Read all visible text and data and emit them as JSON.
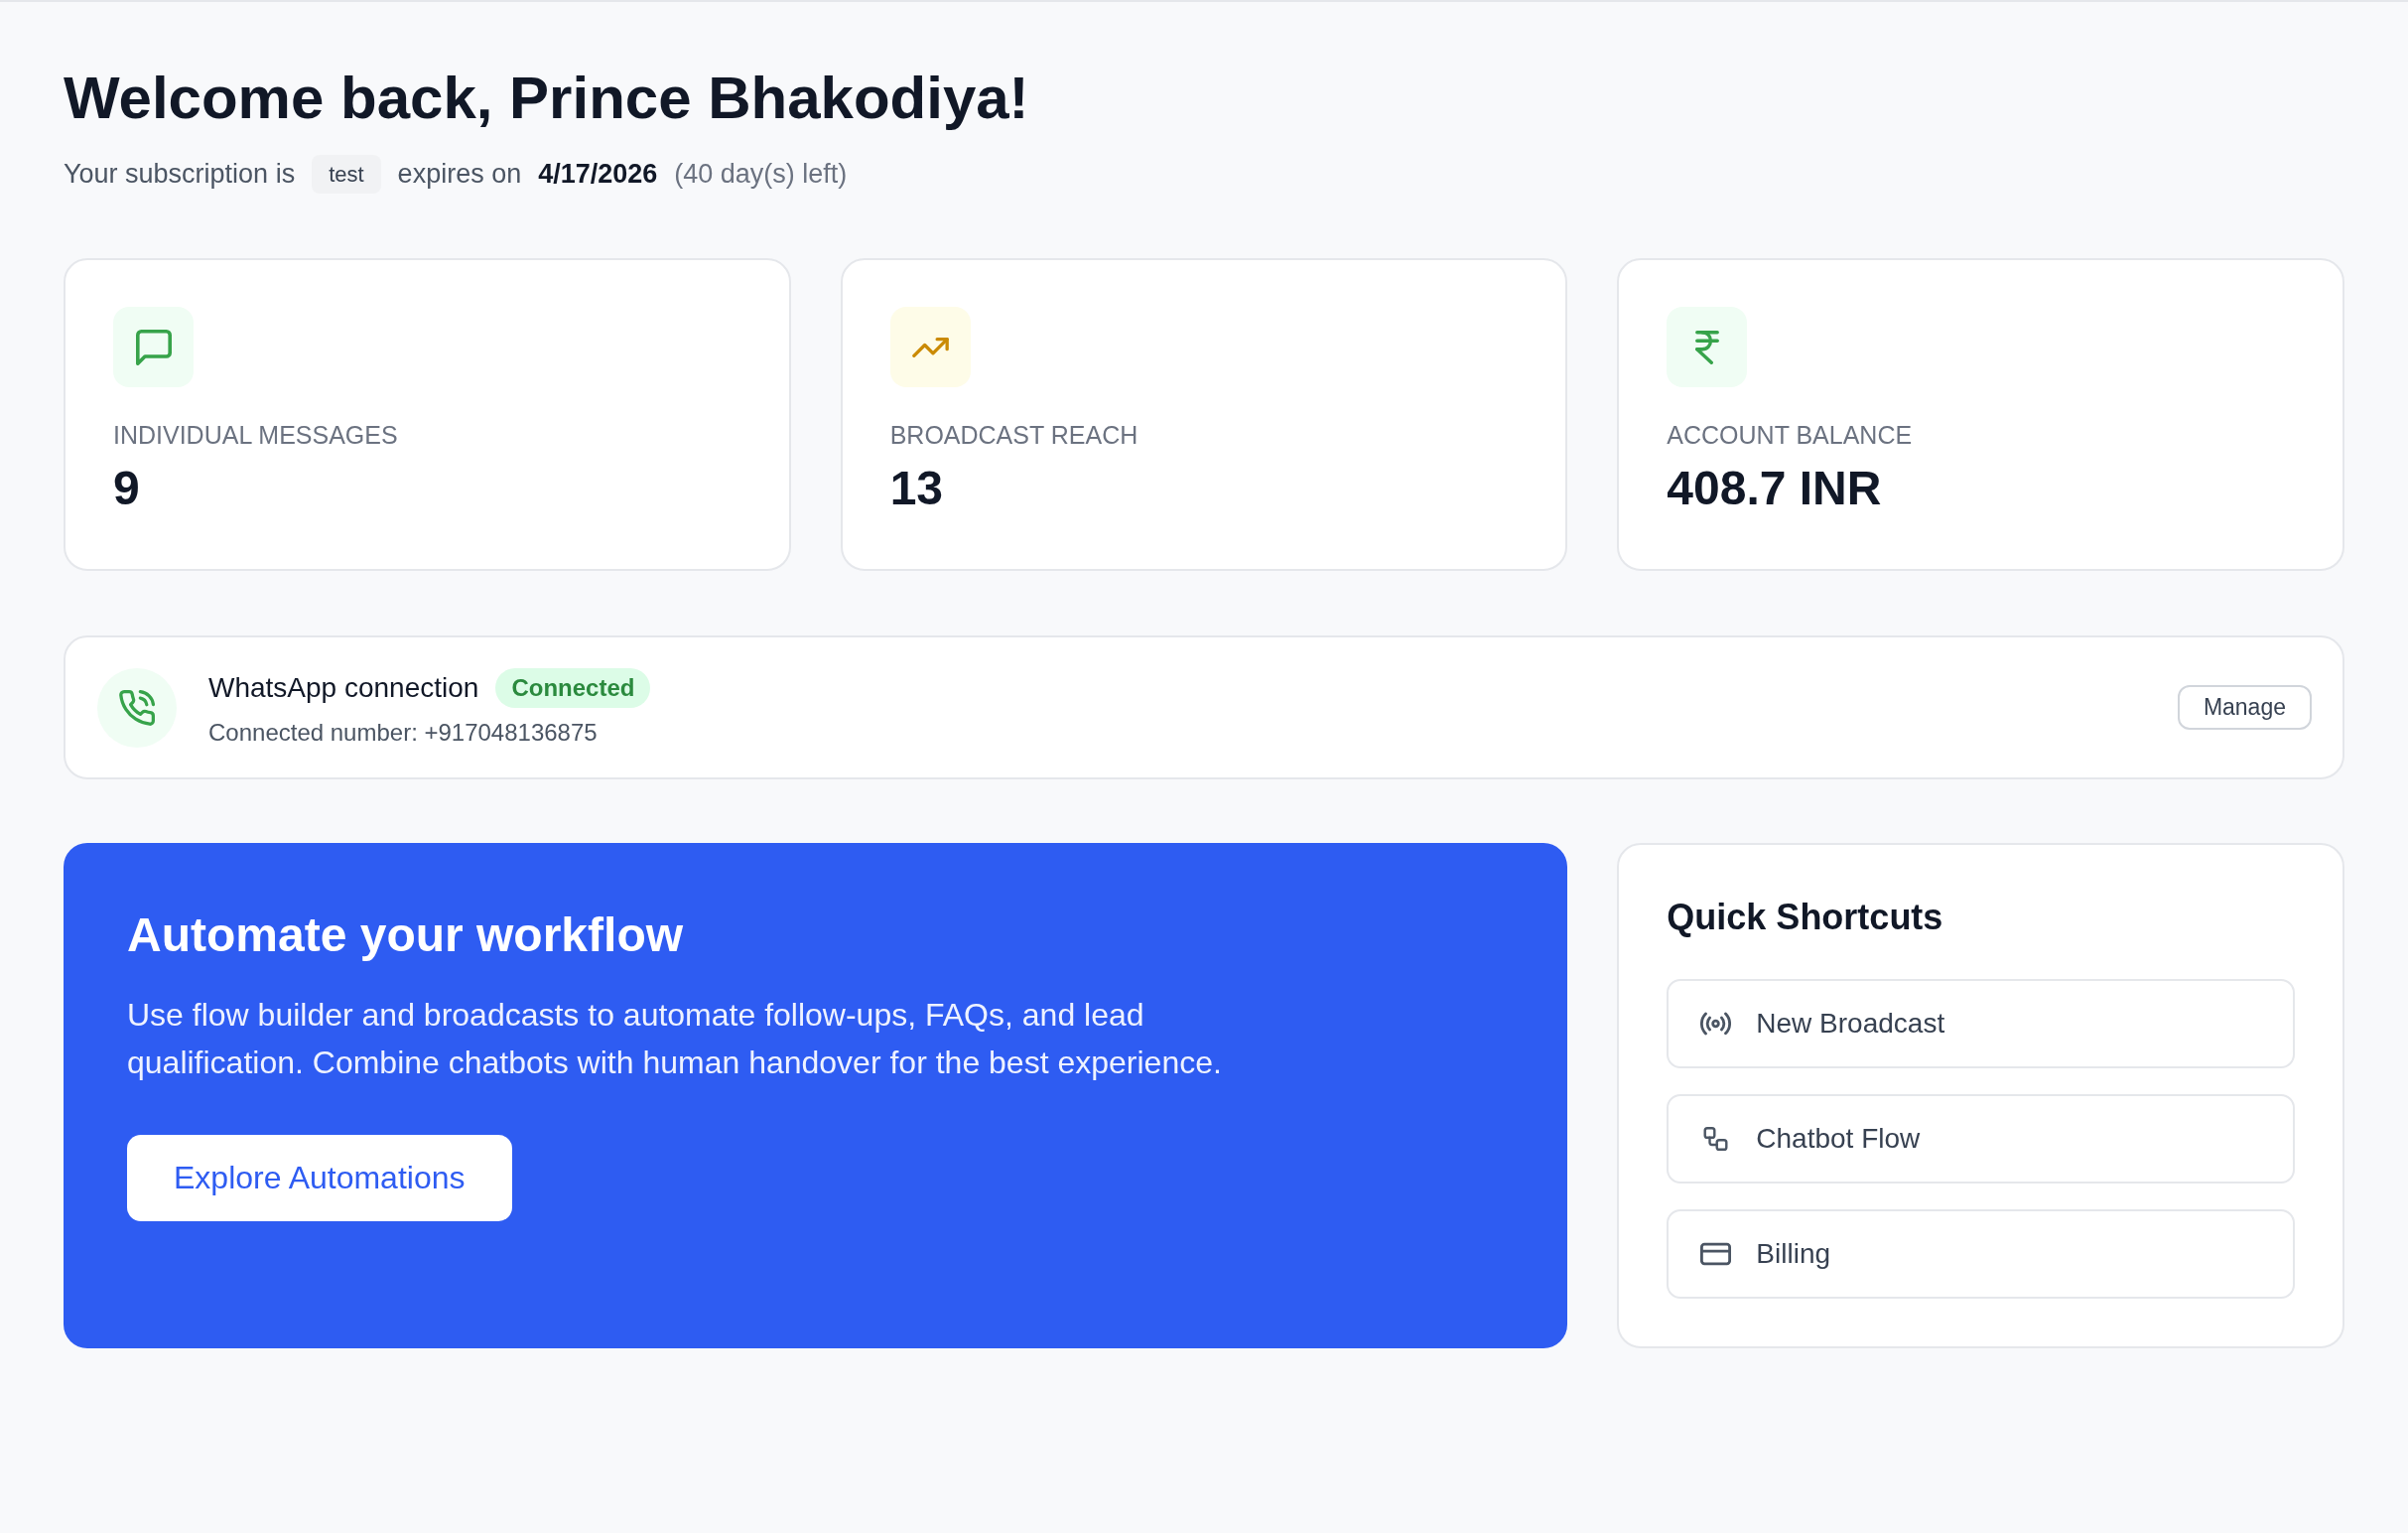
{
  "header": {
    "title": "Welcome back, Prince Bhakodiya!",
    "subscription": {
      "prefix": "Your subscription is",
      "plan": "test",
      "expires_label": "expires on",
      "expiry_date": "4/17/2026",
      "days_left": "(40 day(s) left)"
    }
  },
  "stats": [
    {
      "kind": "messages",
      "label": "INDIVIDUAL MESSAGES",
      "value": "9"
    },
    {
      "kind": "reach",
      "label": "BROADCAST REACH",
      "value": "13"
    },
    {
      "kind": "balance",
      "label": "ACCOUNT BALANCE",
      "value": "408.7 INR"
    }
  ],
  "whatsapp": {
    "title": "WhatsApp connection",
    "status": "Connected",
    "connected": true,
    "number": "Connected number: +917048136875",
    "manage_button": "Manage"
  },
  "automation": {
    "title": "Automate your workflow",
    "description": "Use flow builder and broadcasts to automate follow-ups, FAQs, and lead qualification. Combine chatbots with human handover for the best experience.",
    "button": "Explore Automations"
  },
  "shortcuts": {
    "title": "Quick Shortcuts",
    "items": [
      {
        "kind": "broadcast",
        "label": "New Broadcast"
      },
      {
        "kind": "flow",
        "label": "Chatbot Flow"
      },
      {
        "kind": "billing",
        "label": "Billing"
      }
    ]
  }
}
